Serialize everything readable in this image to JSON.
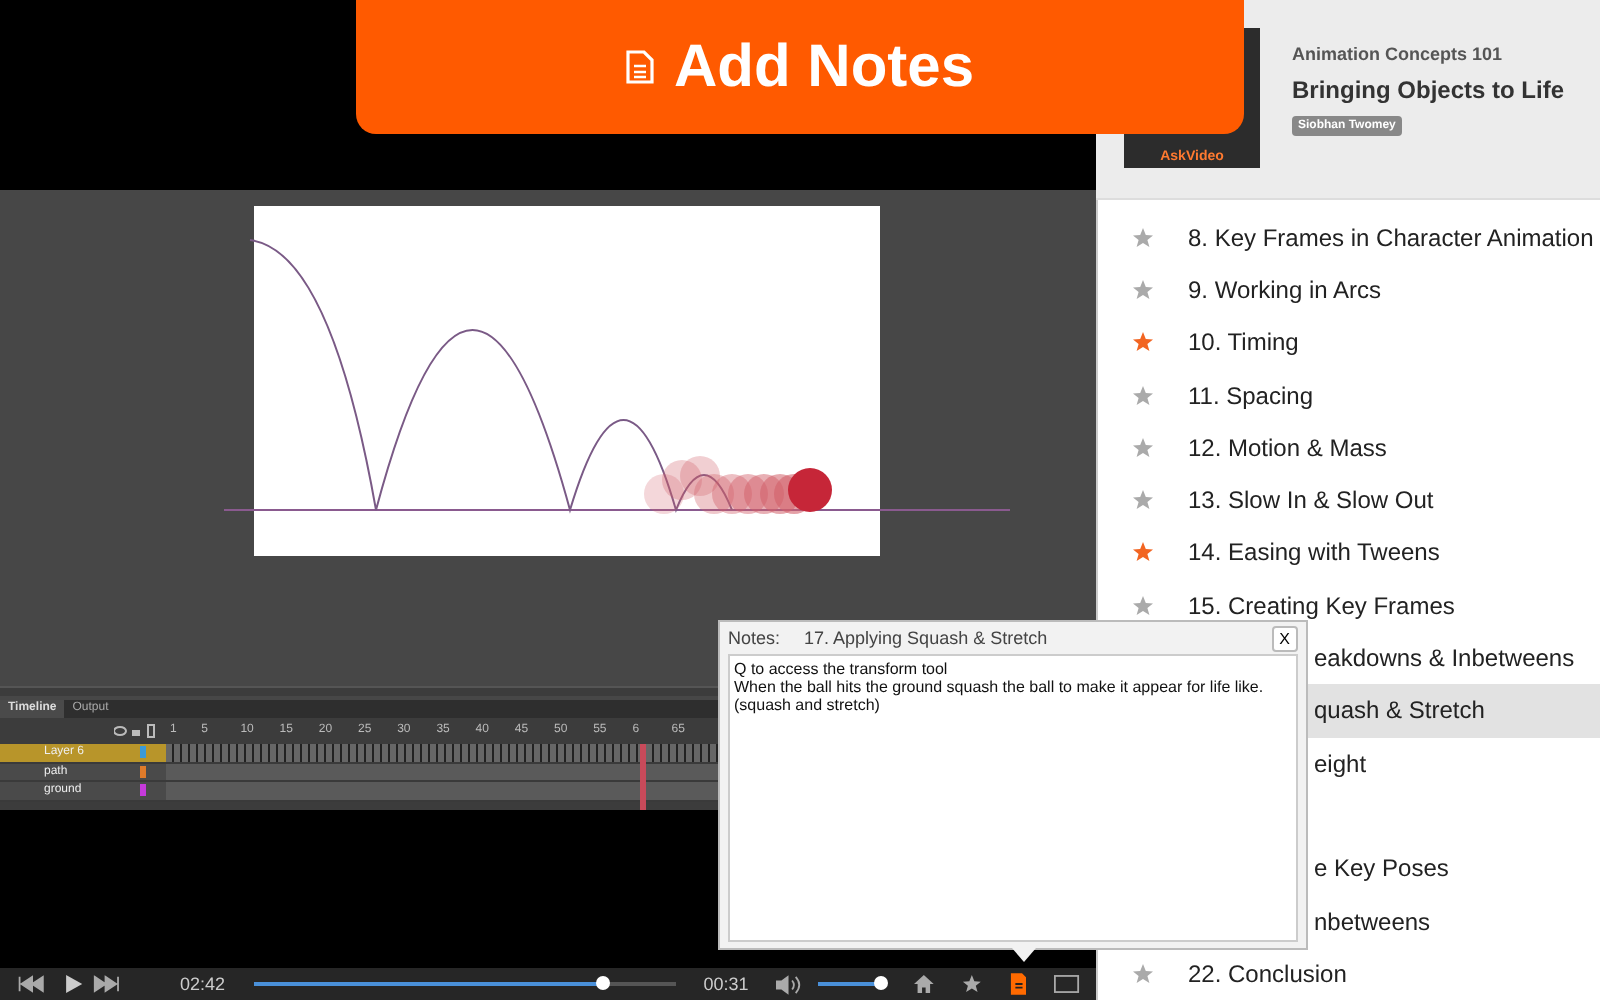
{
  "banner": {
    "title": "Add Notes"
  },
  "course": {
    "series": "Animation Concepts 101",
    "title": "Bringing Objects to Life",
    "author": "Siobhan Twomey",
    "brand": "AskVideo"
  },
  "lessons": [
    {
      "kind": "full",
      "label": "8. Key Frames in Character Animation",
      "starred": false,
      "selected": false
    },
    {
      "kind": "full",
      "label": "9. Working in Arcs",
      "starred": false,
      "selected": false
    },
    {
      "kind": "full",
      "label": "10. Timing",
      "starred": true,
      "selected": false
    },
    {
      "kind": "full",
      "label": "11. Spacing",
      "starred": false,
      "selected": false
    },
    {
      "kind": "full",
      "label": "12. Motion & Mass",
      "starred": false,
      "selected": false
    },
    {
      "kind": "full",
      "label": "13. Slow In & Slow Out",
      "starred": false,
      "selected": false
    },
    {
      "kind": "full",
      "label": "14. Easing with Tweens",
      "starred": true,
      "selected": false
    },
    {
      "kind": "full",
      "label": "15. Creating Key Frames",
      "starred": false,
      "selected": false
    },
    {
      "kind": "partial",
      "label": "eakdowns & Inbetweens",
      "selected": false
    },
    {
      "kind": "partial",
      "label": "quash & Stretch",
      "selected": true
    },
    {
      "kind": "partial",
      "label": "eight",
      "selected": false
    },
    {
      "kind": "covered"
    },
    {
      "kind": "partial",
      "label": "e Key Poses",
      "selected": false
    },
    {
      "kind": "partial",
      "label": "nbetweens",
      "selected": false
    },
    {
      "kind": "full",
      "label": "22. Conclusion",
      "starred": false,
      "selected": false
    }
  ],
  "timeline": {
    "tabs": [
      {
        "label": "Timeline",
        "selected": true
      },
      {
        "label": "Output",
        "selected": false
      }
    ],
    "frame_numbers": [
      "1",
      "5",
      "10",
      "15",
      "20",
      "25",
      "30",
      "35",
      "40",
      "45",
      "50",
      "55",
      "6",
      "65"
    ],
    "layers": [
      {
        "name": "Layer 6",
        "selected": true,
        "color": "#3a9ad9"
      },
      {
        "name": "path",
        "selected": false,
        "color": "#e07b2a"
      },
      {
        "name": "ground",
        "selected": false,
        "color": "#c63adb"
      }
    ]
  },
  "notes": {
    "label": "Notes:",
    "lesson": "17. Applying Squash & Stretch",
    "close": "X",
    "text": "Q to access the transform tool\nWhen the ball hits the ground squash the ball to make it appear for life like.\n(squash and stretch)"
  },
  "player": {
    "elapsed": "02:42",
    "remaining": "00:31",
    "progress": {
      "level": 0.83
    },
    "volume": {
      "level": 0.95
    },
    "notes_active": true
  }
}
